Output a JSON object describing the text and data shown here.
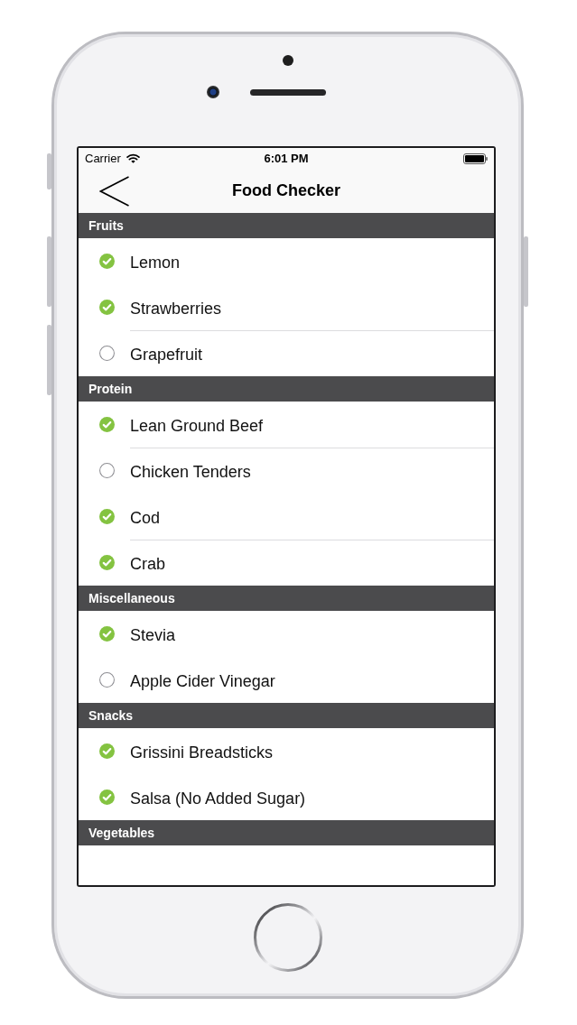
{
  "status_bar": {
    "carrier": "Carrier",
    "time": "6:01 PM"
  },
  "nav_bar": {
    "title": "Food Checker"
  },
  "sections": [
    {
      "title": "Fruits",
      "items": [
        {
          "name": "Lemon",
          "checked": true,
          "divider_above": false
        },
        {
          "name": "Strawberries",
          "checked": true,
          "divider_above": false
        },
        {
          "name": "Grapefruit",
          "checked": false,
          "divider_above": true
        }
      ]
    },
    {
      "title": "Protein",
      "items": [
        {
          "name": "Lean Ground Beef",
          "checked": true,
          "divider_above": false
        },
        {
          "name": "Chicken Tenders",
          "checked": false,
          "divider_above": true
        },
        {
          "name": "Cod",
          "checked": true,
          "divider_above": false
        },
        {
          "name": "Crab",
          "checked": true,
          "divider_above": true
        }
      ]
    },
    {
      "title": "Miscellaneous",
      "items": [
        {
          "name": "Stevia",
          "checked": true,
          "divider_above": false
        },
        {
          "name": "Apple Cider Vinegar",
          "checked": false,
          "divider_above": false
        }
      ]
    },
    {
      "title": "Snacks",
      "items": [
        {
          "name": "Grissini Breadsticks",
          "checked": true,
          "divider_above": false
        },
        {
          "name": "Salsa (No Added Sugar)",
          "checked": true,
          "divider_above": false
        }
      ]
    },
    {
      "title": "Vegetables"
    }
  ]
}
